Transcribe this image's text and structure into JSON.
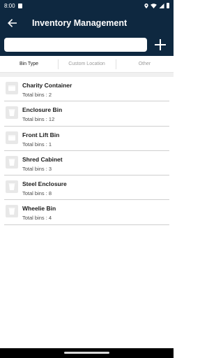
{
  "status_bar": {
    "time": "8:00",
    "icons": [
      "sd-card-icon",
      "location-icon",
      "wifi-icon",
      "signal-icon",
      "battery-icon"
    ]
  },
  "app_bar": {
    "title": "Inventory Management",
    "back_icon": "arrow-left-icon",
    "add_icon": "plus-icon",
    "search": {
      "value": "",
      "placeholder": ""
    }
  },
  "tabs": [
    {
      "label": "Bin Type",
      "active": true
    },
    {
      "label": "Custom Location",
      "active": false
    },
    {
      "label": "Other",
      "active": false
    }
  ],
  "bins": [
    {
      "name": "Charity Container",
      "count_text": "Total bins : 2",
      "icon": "container-icon"
    },
    {
      "name": "Enclosure Bin",
      "count_text": "Total bins : 12",
      "icon": "bin-icon"
    },
    {
      "name": "Front Lift Bin",
      "count_text": "Total bins : 1",
      "icon": "container-icon"
    },
    {
      "name": "Shred Cabinet",
      "count_text": "Total bins : 3",
      "icon": "bin-icon"
    },
    {
      "name": "Steel Enclosure",
      "count_text": "Total bins : 8",
      "icon": "bin-icon"
    },
    {
      "name": "Wheelie Bin",
      "count_text": "Total bins : 4",
      "icon": "bin-icon"
    }
  ],
  "colors": {
    "primary": "#0e2840",
    "background": "#ffffff",
    "divider": "#cfcfcf",
    "tab_inactive": "#9a9a9a"
  }
}
